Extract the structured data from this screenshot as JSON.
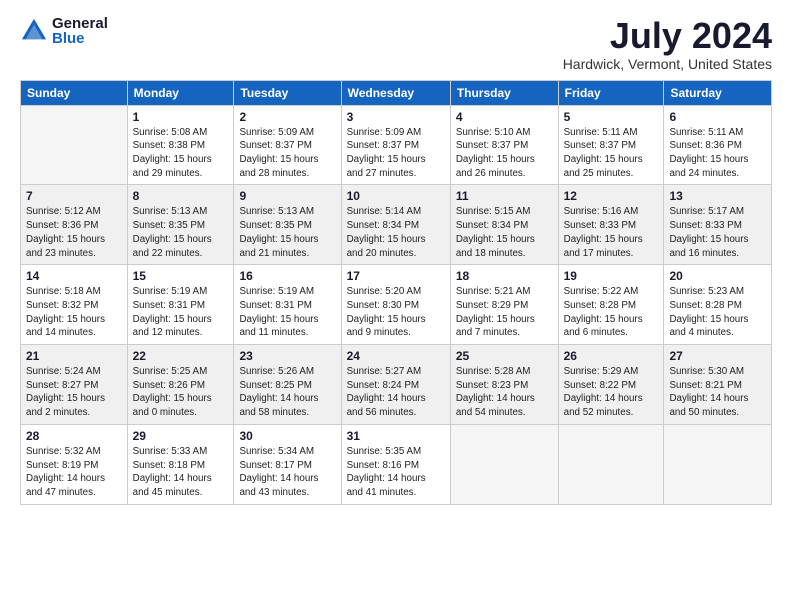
{
  "logo": {
    "general": "General",
    "blue": "Blue"
  },
  "title": "July 2024",
  "location": "Hardwick, Vermont, United States",
  "weekdays": [
    "Sunday",
    "Monday",
    "Tuesday",
    "Wednesday",
    "Thursday",
    "Friday",
    "Saturday"
  ],
  "weeks": [
    [
      {
        "day": "",
        "info": ""
      },
      {
        "day": "1",
        "info": "Sunrise: 5:08 AM\nSunset: 8:38 PM\nDaylight: 15 hours\nand 29 minutes."
      },
      {
        "day": "2",
        "info": "Sunrise: 5:09 AM\nSunset: 8:37 PM\nDaylight: 15 hours\nand 28 minutes."
      },
      {
        "day": "3",
        "info": "Sunrise: 5:09 AM\nSunset: 8:37 PM\nDaylight: 15 hours\nand 27 minutes."
      },
      {
        "day": "4",
        "info": "Sunrise: 5:10 AM\nSunset: 8:37 PM\nDaylight: 15 hours\nand 26 minutes."
      },
      {
        "day": "5",
        "info": "Sunrise: 5:11 AM\nSunset: 8:37 PM\nDaylight: 15 hours\nand 25 minutes."
      },
      {
        "day": "6",
        "info": "Sunrise: 5:11 AM\nSunset: 8:36 PM\nDaylight: 15 hours\nand 24 minutes."
      }
    ],
    [
      {
        "day": "7",
        "info": "Sunrise: 5:12 AM\nSunset: 8:36 PM\nDaylight: 15 hours\nand 23 minutes."
      },
      {
        "day": "8",
        "info": "Sunrise: 5:13 AM\nSunset: 8:35 PM\nDaylight: 15 hours\nand 22 minutes."
      },
      {
        "day": "9",
        "info": "Sunrise: 5:13 AM\nSunset: 8:35 PM\nDaylight: 15 hours\nand 21 minutes."
      },
      {
        "day": "10",
        "info": "Sunrise: 5:14 AM\nSunset: 8:34 PM\nDaylight: 15 hours\nand 20 minutes."
      },
      {
        "day": "11",
        "info": "Sunrise: 5:15 AM\nSunset: 8:34 PM\nDaylight: 15 hours\nand 18 minutes."
      },
      {
        "day": "12",
        "info": "Sunrise: 5:16 AM\nSunset: 8:33 PM\nDaylight: 15 hours\nand 17 minutes."
      },
      {
        "day": "13",
        "info": "Sunrise: 5:17 AM\nSunset: 8:33 PM\nDaylight: 15 hours\nand 16 minutes."
      }
    ],
    [
      {
        "day": "14",
        "info": "Sunrise: 5:18 AM\nSunset: 8:32 PM\nDaylight: 15 hours\nand 14 minutes."
      },
      {
        "day": "15",
        "info": "Sunrise: 5:19 AM\nSunset: 8:31 PM\nDaylight: 15 hours\nand 12 minutes."
      },
      {
        "day": "16",
        "info": "Sunrise: 5:19 AM\nSunset: 8:31 PM\nDaylight: 15 hours\nand 11 minutes."
      },
      {
        "day": "17",
        "info": "Sunrise: 5:20 AM\nSunset: 8:30 PM\nDaylight: 15 hours\nand 9 minutes."
      },
      {
        "day": "18",
        "info": "Sunrise: 5:21 AM\nSunset: 8:29 PM\nDaylight: 15 hours\nand 7 minutes."
      },
      {
        "day": "19",
        "info": "Sunrise: 5:22 AM\nSunset: 8:28 PM\nDaylight: 15 hours\nand 6 minutes."
      },
      {
        "day": "20",
        "info": "Sunrise: 5:23 AM\nSunset: 8:28 PM\nDaylight: 15 hours\nand 4 minutes."
      }
    ],
    [
      {
        "day": "21",
        "info": "Sunrise: 5:24 AM\nSunset: 8:27 PM\nDaylight: 15 hours\nand 2 minutes."
      },
      {
        "day": "22",
        "info": "Sunrise: 5:25 AM\nSunset: 8:26 PM\nDaylight: 15 hours\nand 0 minutes."
      },
      {
        "day": "23",
        "info": "Sunrise: 5:26 AM\nSunset: 8:25 PM\nDaylight: 14 hours\nand 58 minutes."
      },
      {
        "day": "24",
        "info": "Sunrise: 5:27 AM\nSunset: 8:24 PM\nDaylight: 14 hours\nand 56 minutes."
      },
      {
        "day": "25",
        "info": "Sunrise: 5:28 AM\nSunset: 8:23 PM\nDaylight: 14 hours\nand 54 minutes."
      },
      {
        "day": "26",
        "info": "Sunrise: 5:29 AM\nSunset: 8:22 PM\nDaylight: 14 hours\nand 52 minutes."
      },
      {
        "day": "27",
        "info": "Sunrise: 5:30 AM\nSunset: 8:21 PM\nDaylight: 14 hours\nand 50 minutes."
      }
    ],
    [
      {
        "day": "28",
        "info": "Sunrise: 5:32 AM\nSunset: 8:19 PM\nDaylight: 14 hours\nand 47 minutes."
      },
      {
        "day": "29",
        "info": "Sunrise: 5:33 AM\nSunset: 8:18 PM\nDaylight: 14 hours\nand 45 minutes."
      },
      {
        "day": "30",
        "info": "Sunrise: 5:34 AM\nSunset: 8:17 PM\nDaylight: 14 hours\nand 43 minutes."
      },
      {
        "day": "31",
        "info": "Sunrise: 5:35 AM\nSunset: 8:16 PM\nDaylight: 14 hours\nand 41 minutes."
      },
      {
        "day": "",
        "info": ""
      },
      {
        "day": "",
        "info": ""
      },
      {
        "day": "",
        "info": ""
      }
    ]
  ]
}
